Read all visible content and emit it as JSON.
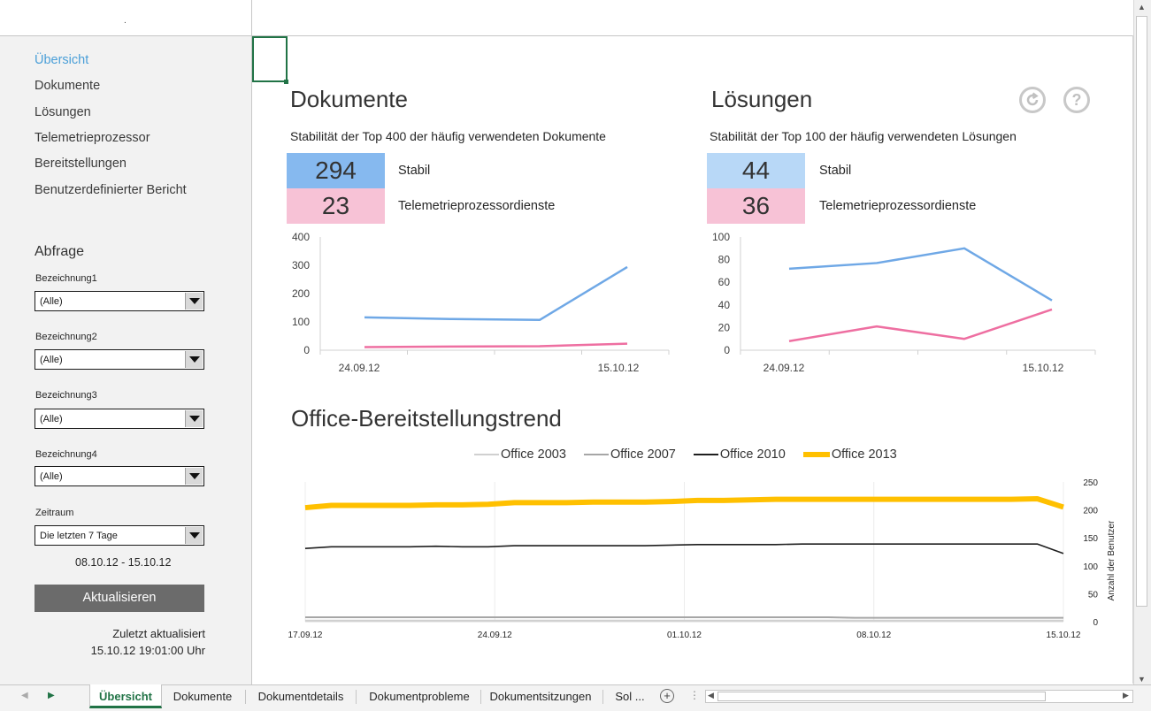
{
  "nav": {
    "items": [
      "Übersicht",
      "Dokumente",
      "Lösungen",
      "Telemetrieprozessor",
      "Bereitstellungen",
      "Benutzerdefinierter Bericht"
    ],
    "active": 0
  },
  "filters": {
    "title": "Abfrage",
    "fields": [
      {
        "label": "Bezeichnung1",
        "value": "(Alle)"
      },
      {
        "label": "Bezeichnung2",
        "value": "(Alle)"
      },
      {
        "label": "Bezeichnung3",
        "value": "(Alle)"
      },
      {
        "label": "Bezeichnung4",
        "value": "(Alle)"
      },
      {
        "label": "Zeitraum",
        "value": "Die letzten 7 Tage"
      }
    ],
    "date_range": "08.10.12 - 15.10.12",
    "refresh_label": "Aktualisieren",
    "last_updated_label": "Zuletzt aktualisiert",
    "last_updated_value": "15.10.12 19:01:00 Uhr"
  },
  "colors": {
    "stable": "#6fa8e6",
    "telemetry": "#ee6fa1",
    "kpi_stable_docs": "#86b9ef",
    "kpi_stable_sol": "#b8d8f7",
    "kpi_telemetry": "#f7c2d6",
    "office2003": "#d0d0d0",
    "office2007": "#a6a6a6",
    "office2010": "#1f1f1f",
    "office2013": "#ffc000"
  },
  "documents": {
    "title": "Dokumente",
    "subtitle": "Stabilität der Top 400 der häufig verwendeten Dokumente",
    "kpis": [
      {
        "value": "294",
        "label": "Stabil"
      },
      {
        "value": "23",
        "label": "Telemetrieprozessordienste"
      }
    ]
  },
  "solutions": {
    "title": "Lösungen",
    "subtitle": "Stabilität der Top 100 der häufig verwendeten Lösungen",
    "kpis": [
      {
        "value": "44",
        "label": "Stabil"
      },
      {
        "value": "36",
        "label": "Telemetrieprozessordienste"
      }
    ]
  },
  "trend": {
    "title": "Office-Bereitstellungstrend"
  },
  "chart_data": [
    {
      "type": "line",
      "x_tick_labels": [
        "24.09.12",
        "15.10.12"
      ],
      "ylim": [
        0,
        400
      ],
      "yticks": [
        0,
        100,
        200,
        300,
        400
      ],
      "points": 4,
      "series": [
        {
          "values": [
            116,
            110,
            107,
            294
          ]
        },
        {
          "values": [
            11,
            13,
            14,
            23
          ]
        }
      ]
    },
    {
      "type": "line",
      "x_tick_labels": [
        "24.09.12",
        "15.10.12"
      ],
      "ylim": [
        0,
        100
      ],
      "yticks": [
        0,
        20,
        40,
        60,
        80,
        100
      ],
      "points": 4,
      "series": [
        {
          "values": [
            72,
            77,
            90,
            44
          ]
        },
        {
          "values": [
            8,
            21,
            10,
            36
          ]
        }
      ]
    },
    {
      "type": "line",
      "x_tick_labels": [
        "17.09.12",
        "24.09.12",
        "01.10.12",
        "08.10.12",
        "15.10.12"
      ],
      "ylabel": "Anzahl der Benutzer",
      "ylim": [
        0,
        250
      ],
      "yticks": [
        0,
        50,
        100,
        150,
        200,
        250
      ],
      "points": 30,
      "series": [
        {
          "name": "Office 2003",
          "values": [
            2,
            2,
            2,
            2,
            2,
            2,
            2,
            2,
            2,
            2,
            2,
            2,
            2,
            2,
            2,
            2,
            2,
            2,
            2,
            2,
            2,
            2,
            2,
            2,
            2,
            2,
            2,
            2,
            2,
            2
          ]
        },
        {
          "name": "Office 2007",
          "values": [
            8,
            8,
            8,
            8,
            8,
            8,
            8,
            8,
            8,
            8,
            8,
            8,
            8,
            8,
            8,
            8,
            8,
            8,
            8,
            8,
            8,
            7,
            7,
            7,
            7,
            7,
            7,
            7,
            7,
            7
          ]
        },
        {
          "name": "Office 2010",
          "values": [
            131,
            134,
            134,
            134,
            134,
            135,
            134,
            134,
            136,
            136,
            136,
            136,
            136,
            136,
            137,
            138,
            138,
            138,
            138,
            139,
            139,
            139,
            139,
            139,
            139,
            139,
            139,
            139,
            139,
            122
          ]
        },
        {
          "name": "Office 2013",
          "values": [
            204,
            208,
            208,
            208,
            208,
            209,
            209,
            210,
            213,
            213,
            213,
            214,
            214,
            214,
            215,
            217,
            217,
            218,
            219,
            219,
            219,
            219,
            219,
            219,
            219,
            219,
            219,
            219,
            220,
            205
          ]
        }
      ]
    }
  ],
  "icons": {
    "refresh": "refresh-icon",
    "help": "help-icon"
  },
  "tabs": [
    "Übersicht",
    "Dokumente",
    "Dokumentdetails",
    "Dokumentprobleme",
    "Dokumentsitzungen",
    "Sol ..."
  ],
  "active_tab": 0
}
